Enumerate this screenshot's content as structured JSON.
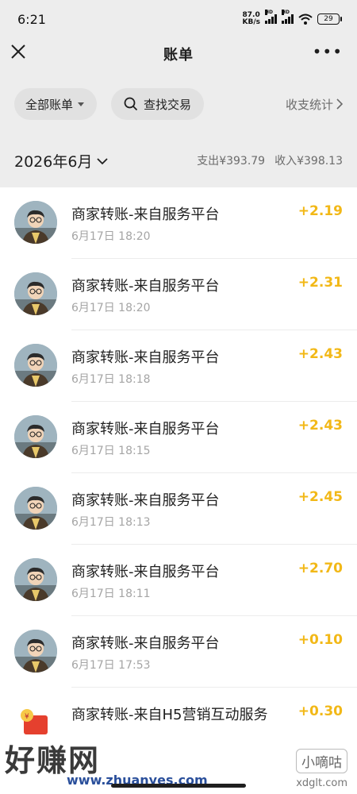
{
  "status_bar": {
    "time": "6:21",
    "net_speed_value": "87.0",
    "net_speed_unit": "KB/s",
    "signal_label": "HD",
    "battery": "29"
  },
  "title_bar": {
    "title": "账单"
  },
  "filters": {
    "all_bills_label": "全部账单",
    "search_label": "查找交易",
    "stats_label": "收支统计"
  },
  "month_header": {
    "month": "2026年6月",
    "expense_label": "支出",
    "expense_amount": "¥393.79",
    "income_label": "收入",
    "income_amount": "¥398.13"
  },
  "transactions": [
    {
      "title": "商家转账-来自服务平台",
      "time": "6月17日 18:20",
      "amount": "+2.19"
    },
    {
      "title": "商家转账-来自服务平台",
      "time": "6月17日 18:20",
      "amount": "+2.31"
    },
    {
      "title": "商家转账-来自服务平台",
      "time": "6月17日 18:18",
      "amount": "+2.43"
    },
    {
      "title": "商家转账-来自服务平台",
      "time": "6月17日 18:15",
      "amount": "+2.43"
    },
    {
      "title": "商家转账-来自服务平台",
      "time": "6月17日 18:13",
      "amount": "+2.45"
    },
    {
      "title": "商家转账-来自服务平台",
      "time": "6月17日 18:11",
      "amount": "+2.70"
    },
    {
      "title": "商家转账-来自服务平台",
      "time": "6月17日 17:53",
      "amount": "+0.10"
    },
    {
      "title": "商家转账-来自H5营销互动服务",
      "time": "",
      "amount": "+0.30"
    }
  ],
  "watermarks": {
    "main": "好赚网",
    "url": "www.zhuanyes.com",
    "badge": "小嘀咕",
    "url2": "xdglt.com"
  },
  "colors": {
    "accent_income": "#f2b817",
    "background": "#ededed",
    "list_background": "#ffffff"
  }
}
